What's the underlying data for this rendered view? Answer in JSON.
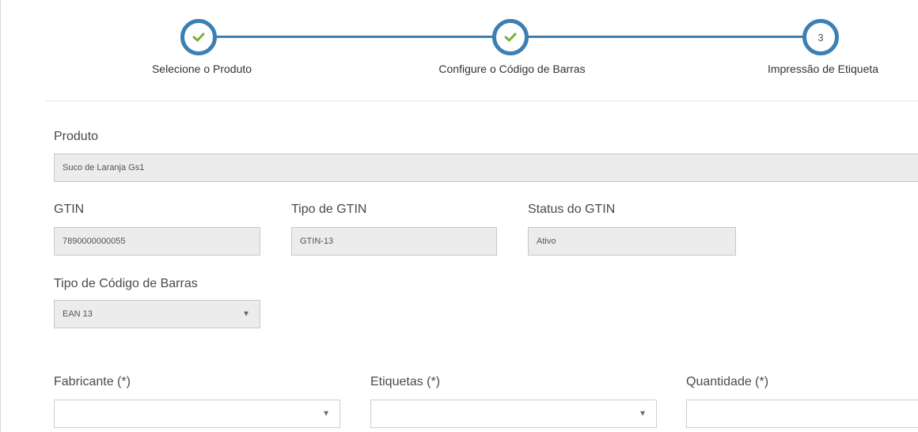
{
  "stepper": {
    "steps": [
      {
        "label": "Selecione o Produto",
        "state": "done",
        "icon": "check-icon"
      },
      {
        "label": "Configure o Código de Barras",
        "state": "done",
        "icon": "check-icon"
      },
      {
        "label": "Impressão de Etiqueta",
        "state": "current",
        "number": "3"
      }
    ],
    "colors": {
      "line": "#3b7fb3",
      "check": "#7ab03c"
    }
  },
  "form": {
    "produto": {
      "label": "Produto",
      "value": "Suco de Laranja Gs1"
    },
    "gtin": {
      "label": "GTIN",
      "value": "7890000000055"
    },
    "tipo_gtin": {
      "label": "Tipo de GTIN",
      "value": "GTIN-13"
    },
    "status_gtin": {
      "label": "Status do GTIN",
      "value": "Ativo"
    },
    "tipo_codigo": {
      "label": "Tipo de Código de Barras",
      "value": "EAN 13"
    },
    "fabricante": {
      "label": "Fabricante (*)",
      "value": ""
    },
    "etiquetas": {
      "label": "Etiquetas (*)",
      "value": ""
    },
    "quantidade": {
      "label": "Quantidade (*)",
      "value": ""
    }
  }
}
